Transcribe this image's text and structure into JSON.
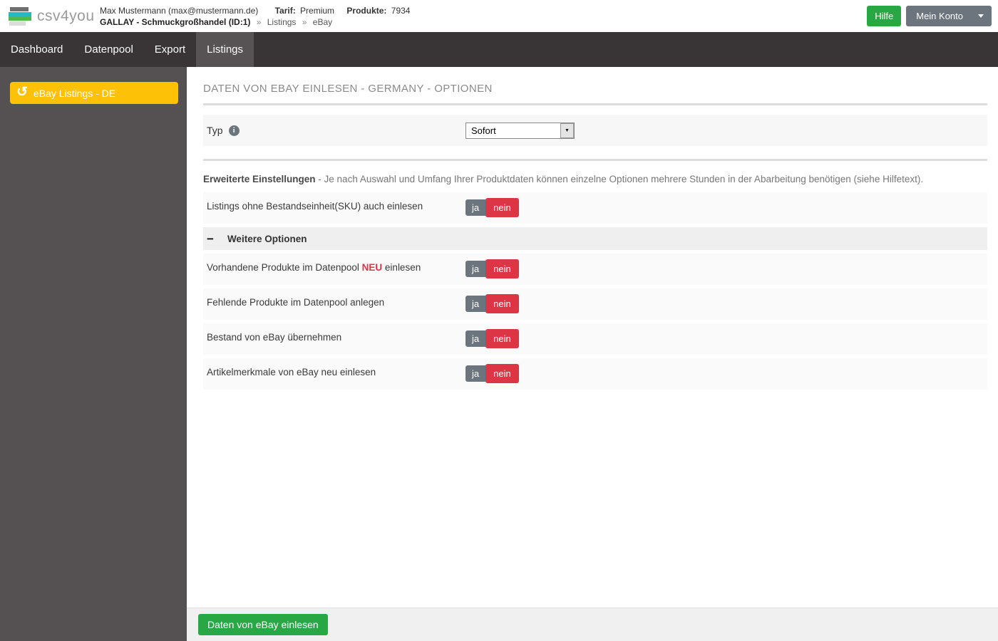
{
  "header": {
    "logo_text": "csv4you",
    "user_line": "Max Mustermann (max@mustermann.de)",
    "tarif_label": "Tarif:",
    "tarif_value": "Premium",
    "produkte_label": "Produkte:",
    "produkte_value": "7934",
    "breadcrumb_account": "GALLAY - Schmuckgroßhandel (ID:1)",
    "breadcrumb_sep": "»",
    "breadcrumb_listings": "Listings",
    "breadcrumb_ebay": "eBay",
    "help_button": "Hilfe",
    "account_button": "Mein Konto"
  },
  "nav": {
    "items": [
      {
        "label": "Dashboard",
        "active": false
      },
      {
        "label": "Datenpool",
        "active": false
      },
      {
        "label": "Export",
        "active": false
      },
      {
        "label": "Listings",
        "active": true
      }
    ]
  },
  "sidebar": {
    "ebay_listings_button": "eBay Listings - DE"
  },
  "main": {
    "title": "DATEN VON EBAY EINLESEN - GERMANY - OPTIONEN",
    "typ_label": "Typ",
    "typ_select_value": "Sofort",
    "advanced_heading": "Erweiterte Einstellungen",
    "advanced_text": " - Je nach Auswahl und Umfang Ihrer Produktdaten können einzelne Optionen mehrere Stunden in der Abarbeitung benötigen (siehe Hilfetext).",
    "group_header": "Weitere Optionen",
    "options": [
      {
        "label": "Listings ohne Bestandseinheit(SKU) auch einlesen",
        "selected": "nein"
      },
      {
        "prefix": "Vorhandene Produkte im Datenpool ",
        "highlight": "NEU",
        "suffix": " einlesen",
        "selected": "nein"
      },
      {
        "label": "Fehlende Produkte im Datenpool anlegen",
        "selected": "nein"
      },
      {
        "label": "Bestand von eBay übernehmen",
        "selected": "nein"
      },
      {
        "label": "Artikelmerkmale von eBay neu einlesen",
        "selected": "nein"
      }
    ],
    "toggle_yes": "ja",
    "toggle_no": "nein",
    "submit_button": "Daten von eBay einlesen"
  },
  "colors": {
    "accent_green": "#28a745",
    "accent_yellow": "#fdc107",
    "accent_red": "#dc3545",
    "button_gray": "#6c757d",
    "nav_bg": "#393536",
    "sidebar_bg": "#555152"
  }
}
